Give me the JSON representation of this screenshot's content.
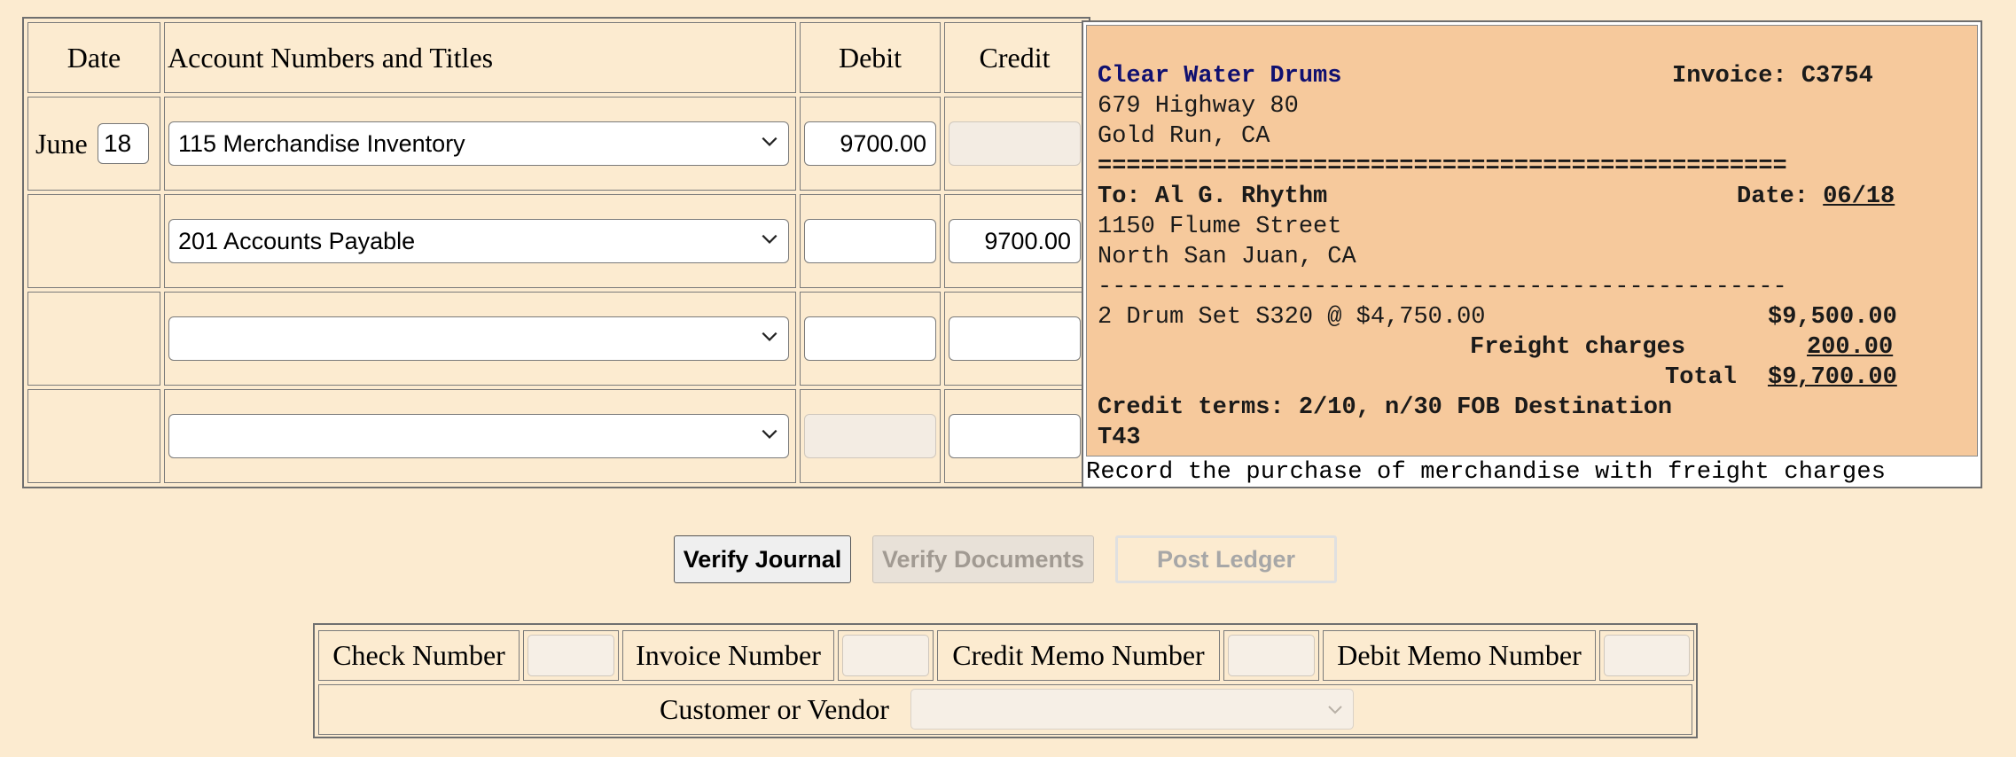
{
  "journal": {
    "headers": {
      "date": "Date",
      "account": "Account Numbers and Titles",
      "debit": "Debit",
      "credit": "Credit"
    },
    "rows": [
      {
        "month": "June",
        "day": "18",
        "account": "115 Merchandise Inventory",
        "debit": "9700.00",
        "credit": ""
      },
      {
        "month": "",
        "day": "",
        "account": "201 Accounts Payable",
        "debit": "",
        "credit": "9700.00"
      },
      {
        "month": "",
        "day": "",
        "account": "",
        "debit": "",
        "credit": ""
      },
      {
        "month": "",
        "day": "",
        "account": "",
        "debit": "",
        "credit": ""
      }
    ]
  },
  "invoice": {
    "vendor": "Clear Water Drums",
    "invoice_label": "Invoice: C3754",
    "address1": "679 Highway 80",
    "address2": "Gold Run, CA",
    "double_rule": "================================================",
    "to_line": "To: Al G. Rhythm",
    "date_label": "Date: ",
    "date_value": "06/18",
    "to_address1": "1150 Flume Street",
    "to_address2": "North San Juan, CA",
    "single_rule": "------------------------------------------------",
    "item_line": "2 Drum Set S320 @ $4,750.00",
    "item_amount": "$9,500.00",
    "freight_label": "Freight charges",
    "freight_amount": "200.00",
    "total_label": "Total",
    "total_amount": "$9,700.00",
    "terms": "Credit terms: 2/10, n/30 FOB Destination",
    "code": "T43",
    "caption": "Record the purchase of merchandise with freight charges"
  },
  "buttons": {
    "verify_journal": "Verify Journal",
    "verify_documents": "Verify Documents",
    "post_ledger": "Post Ledger"
  },
  "documents": {
    "check_number": "Check Number",
    "invoice_number": "Invoice Number",
    "credit_memo_number": "Credit Memo Number",
    "debit_memo_number": "Debit Memo Number",
    "customer_or_vendor": "Customer or Vendor"
  },
  "colors": {
    "background": "#fcebd0",
    "invoice_bg": "#f6c99c",
    "vendor_text": "#101070"
  }
}
